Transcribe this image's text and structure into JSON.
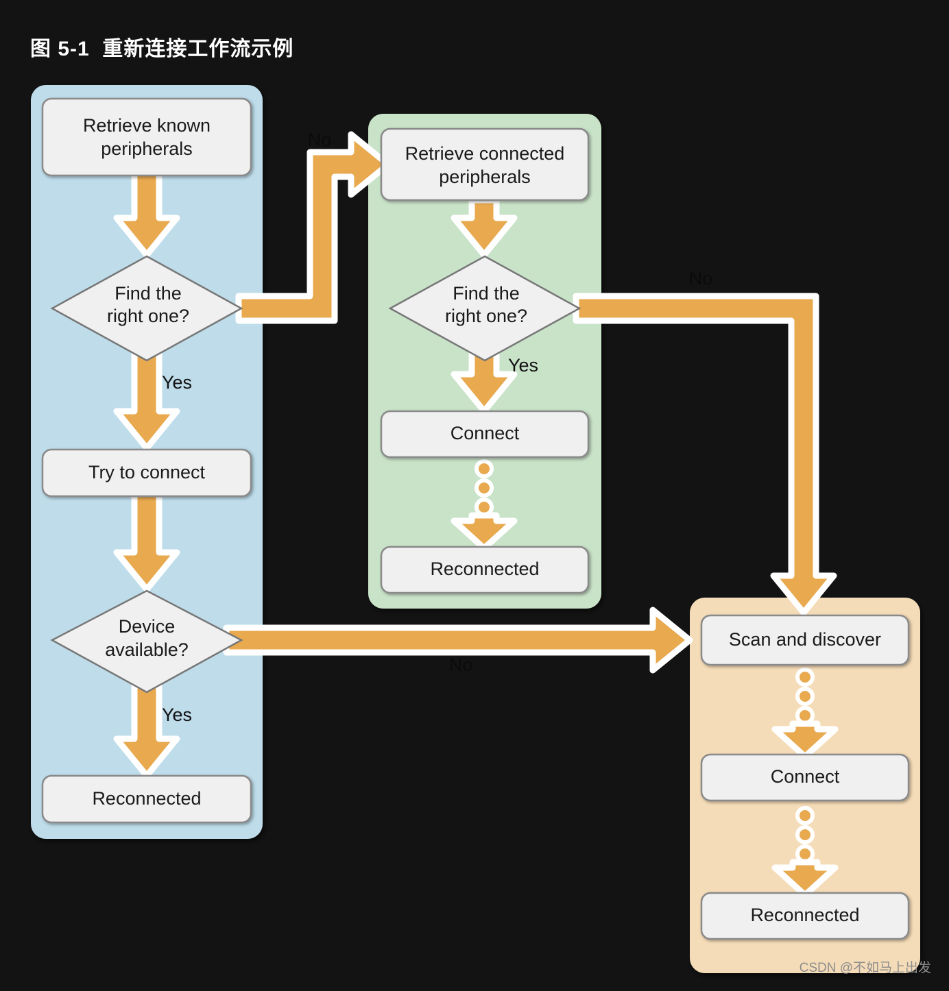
{
  "title": "图 5-1  重新连接工作流示例",
  "watermark": "CSDN @不如马上出发",
  "colors": {
    "background": "#131313",
    "panel_blue": "#bedcea",
    "panel_green": "#c9e3c9",
    "panel_orange": "#f5dcb8",
    "node_fill": "#f0f0f0",
    "node_stroke": "#8a8a8a",
    "arrow_fill": "#e8a94f",
    "arrow_stroke": "#ffffff",
    "title_text": "#ffffff",
    "node_text": "#1a1a1a",
    "watermark_text": "#8d8d8d"
  },
  "panels": [
    {
      "id": "known-peripherals-panel",
      "color_name": "blue"
    },
    {
      "id": "connected-peripherals-panel",
      "color_name": "green"
    },
    {
      "id": "scan-discover-panel",
      "color_name": "orange"
    }
  ],
  "flow": {
    "blue_panel": {
      "nodes": [
        {
          "id": "retrieve-known-peripherals",
          "shape": "box",
          "line1": "Retrieve known",
          "line2": "peripherals"
        },
        {
          "id": "find-right-one-known",
          "shape": "diamond",
          "line1": "Find the",
          "line2": "right one?"
        },
        {
          "id": "try-to-connect",
          "shape": "box",
          "line1": "Try to connect",
          "line2": ""
        },
        {
          "id": "device-available",
          "shape": "diamond",
          "line1": "Device",
          "line2": "available?"
        },
        {
          "id": "reconnected-blue",
          "shape": "box",
          "line1": "Reconnected",
          "line2": ""
        }
      ],
      "edge_labels": {
        "find_right_one_yes": "Yes",
        "find_right_one_no": "No",
        "device_available_yes": "Yes",
        "device_available_no": "No"
      }
    },
    "green_panel": {
      "nodes": [
        {
          "id": "retrieve-connected-peripherals",
          "shape": "box",
          "line1": "Retrieve connected",
          "line2": "peripherals"
        },
        {
          "id": "find-right-one-connected",
          "shape": "diamond",
          "line1": "Find the",
          "line2": "right one?"
        },
        {
          "id": "connect-green",
          "shape": "box",
          "line1": "Connect",
          "line2": ""
        },
        {
          "id": "reconnected-green",
          "shape": "box",
          "line1": "Reconnected",
          "line2": ""
        }
      ],
      "edge_labels": {
        "find_right_one_yes": "Yes",
        "find_right_one_no": "No"
      }
    },
    "orange_panel": {
      "nodes": [
        {
          "id": "scan-and-discover",
          "shape": "box",
          "line1": "Scan and discover",
          "line2": ""
        },
        {
          "id": "connect-orange",
          "shape": "box",
          "line1": "Connect",
          "line2": ""
        },
        {
          "id": "reconnected-orange",
          "shape": "box",
          "line1": "Reconnected",
          "line2": ""
        }
      ]
    }
  }
}
